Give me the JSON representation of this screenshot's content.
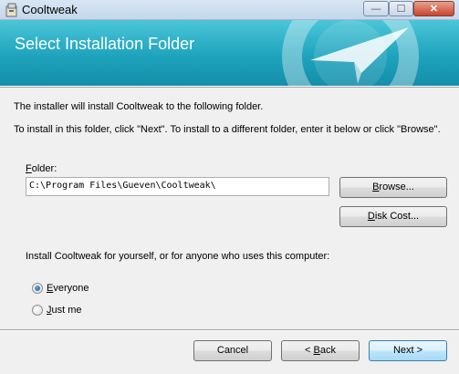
{
  "window": {
    "title": "Cooltweak",
    "controls": {
      "minimize": "—",
      "maximize": "☐",
      "close": "✕"
    }
  },
  "banner": {
    "title": "Select Installation Folder"
  },
  "intro": {
    "line1": "The installer will install Cooltweak to the following folder.",
    "line2": "To install in this folder, click \"Next\". To install to a different folder, enter it below or click \"Browse\"."
  },
  "folder": {
    "label_first": "F",
    "label_rest": "older:",
    "value": "C:\\Program Files\\Gueven\\Cooltweak\\"
  },
  "buttons": {
    "browse_first": "B",
    "browse_rest": "rowse...",
    "diskcost_first": "D",
    "diskcost_rest": "isk Cost...",
    "cancel": "Cancel",
    "back_prefix": "< ",
    "back_first": "B",
    "back_rest": "ack",
    "next": "Next >"
  },
  "install_for": {
    "question": "Install Cooltweak for yourself, or for anyone who uses this computer:",
    "options": [
      {
        "label_first": "E",
        "label_rest": "veryone",
        "selected": true
      },
      {
        "label_first": "J",
        "label_rest": "ust me",
        "selected": false
      }
    ]
  },
  "colors": {
    "banner": "#1ea3bd",
    "accent": "#3c7fb1"
  }
}
